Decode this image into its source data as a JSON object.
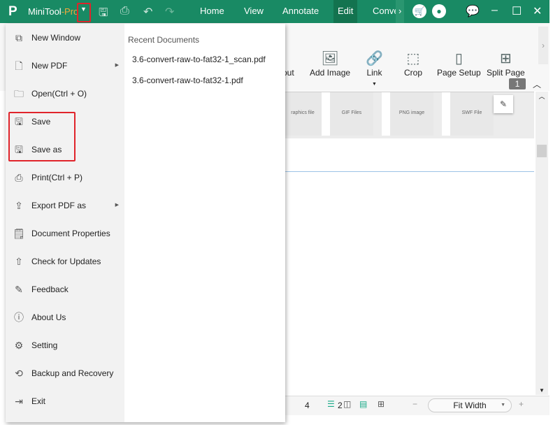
{
  "titlebar": {
    "app_name": "MiniTool",
    "app_suffix": "-Pro",
    "tabs": [
      "Home",
      "View",
      "Annotate",
      "Edit",
      "Conve"
    ],
    "active_tab": "Edit",
    "accent": "#198a64"
  },
  "ribbon": {
    "items": [
      "-out",
      "Add Image",
      "Link",
      "Crop",
      "Page Setup",
      "Split Page"
    ]
  },
  "document": {
    "cells": [
      "raphics file",
      "GIF Files",
      "PNG image",
      "SWF File"
    ],
    "page_badge": "1"
  },
  "status": {
    "page": "4",
    "zoom": "Fit Width",
    "two": "2"
  },
  "menu": {
    "items": [
      {
        "label": "New Window",
        "icon": "new-window-icon"
      },
      {
        "label": "New PDF",
        "icon": "new-pdf-icon",
        "submenu": true
      },
      {
        "label": "Open(Ctrl + O)",
        "icon": "folder-icon"
      },
      {
        "label": "Save",
        "icon": "save-icon"
      },
      {
        "label": "Save as",
        "icon": "save-as-icon"
      },
      {
        "label": "Print(Ctrl + P)",
        "icon": "print-icon"
      },
      {
        "label": "Export PDF as",
        "icon": "export-icon",
        "submenu": true
      },
      {
        "label": "Document Properties",
        "icon": "properties-icon"
      },
      {
        "label": "Check for Updates",
        "icon": "update-icon"
      },
      {
        "label": "Feedback",
        "icon": "feedback-icon"
      },
      {
        "label": "About Us",
        "icon": "info-icon"
      },
      {
        "label": "Setting",
        "icon": "gear-icon"
      },
      {
        "label": "Backup and Recovery",
        "icon": "backup-icon"
      },
      {
        "label": "Exit",
        "icon": "exit-icon"
      }
    ],
    "recent_heading": "Recent Documents",
    "recent": [
      "3.6-convert-raw-to-fat32-1_scan.pdf",
      "3.6-convert-raw-to-fat32-1.pdf"
    ]
  }
}
